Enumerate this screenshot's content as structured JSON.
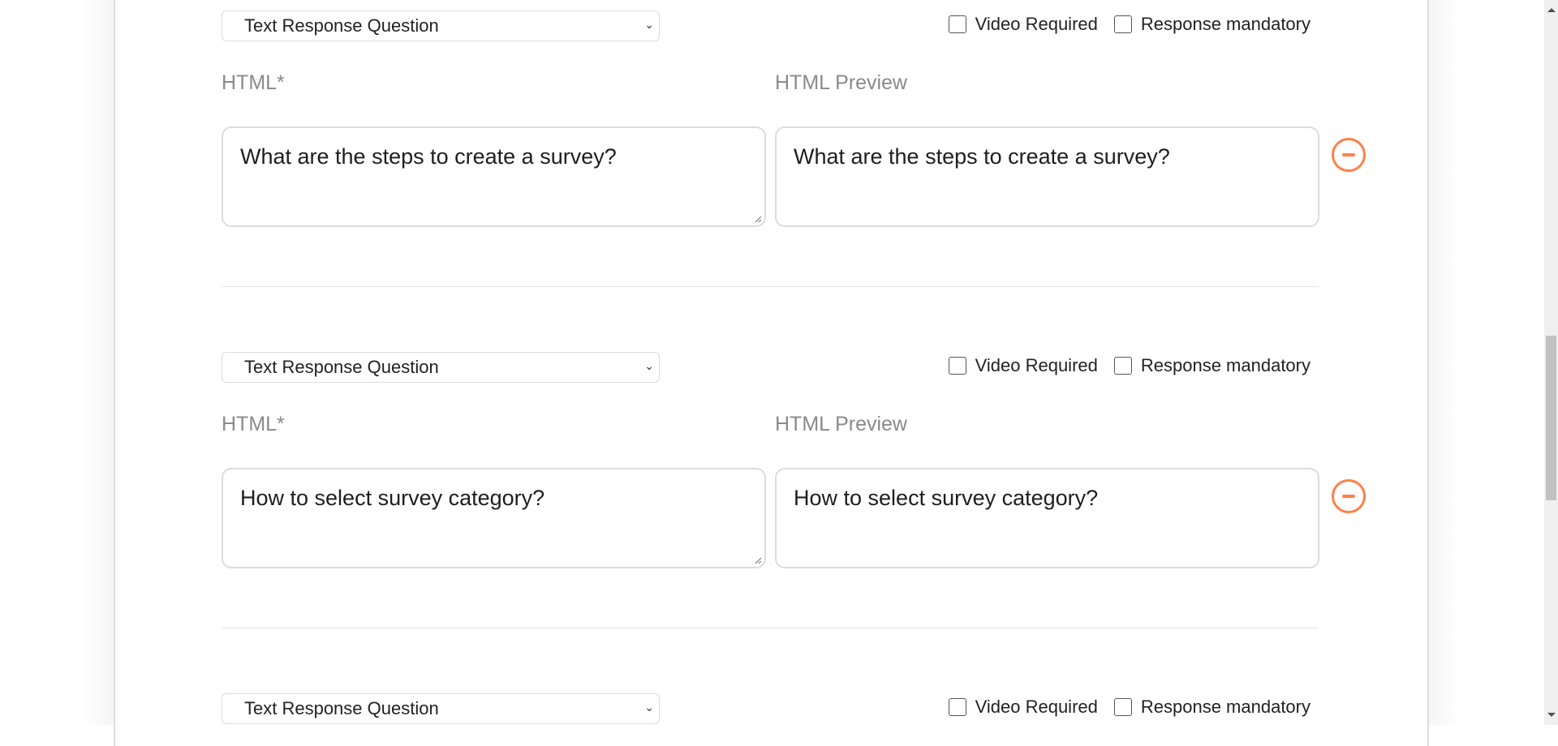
{
  "questions": [
    {
      "type_select": "Text Response Question",
      "options": {
        "video_required": "Video Required",
        "response_mandatory": "Response mandatory"
      },
      "video_required_checked": false,
      "response_mandatory_checked": false,
      "html_label": "HTML*",
      "preview_label": "HTML Preview",
      "html_value": "What are the steps to create a survey?",
      "preview_value": "What are the steps to create a survey?"
    },
    {
      "type_select": "Text Response Question",
      "options": {
        "video_required": "Video Required",
        "response_mandatory": "Response mandatory"
      },
      "video_required_checked": false,
      "response_mandatory_checked": false,
      "html_label": "HTML*",
      "preview_label": "HTML Preview",
      "html_value": "How to select survey category?",
      "preview_value": "How to select survey category?"
    },
    {
      "type_select": "Text Response Question",
      "options": {
        "video_required": "Video Required",
        "response_mandatory": "Response mandatory"
      },
      "video_required_checked": false,
      "response_mandatory_checked": false
    }
  ],
  "colors": {
    "remove_accent": "#ff8049",
    "label_gray": "#8a8a8a",
    "border": "#dcdcdc"
  },
  "icons": {
    "remove": "minus-circle-icon",
    "select": "chevron-down-icon"
  },
  "scrollbar": {
    "position_fraction": 0.52
  }
}
